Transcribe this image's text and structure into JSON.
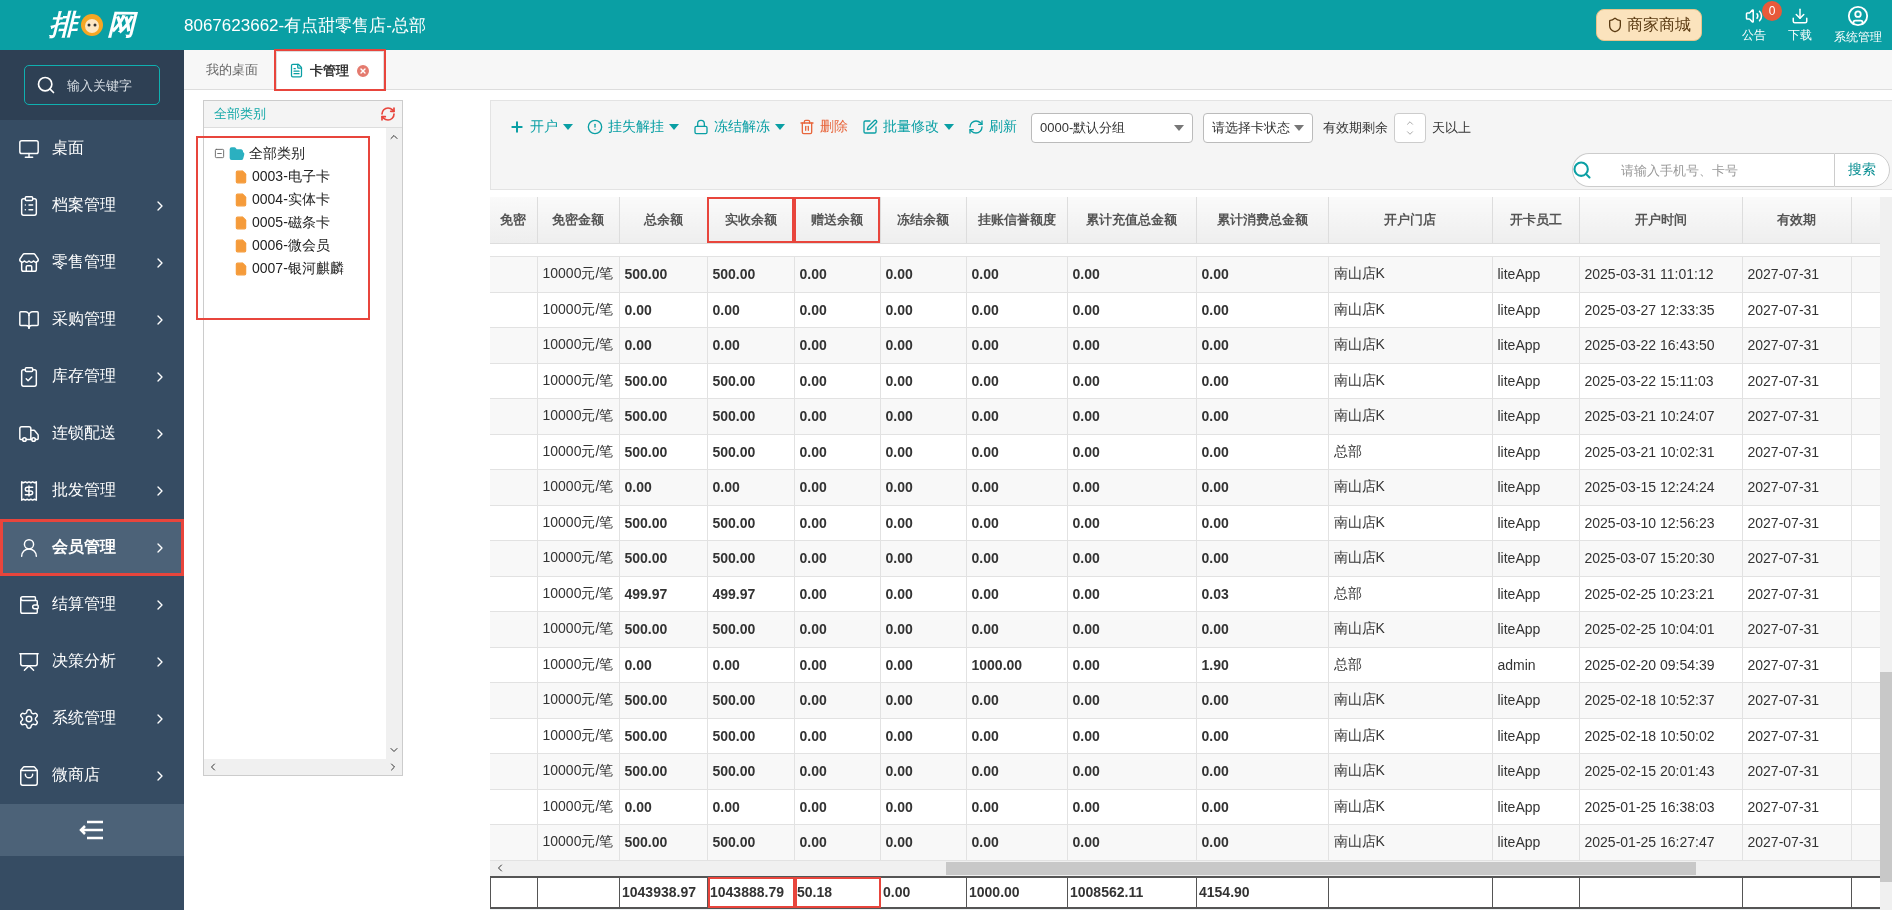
{
  "header": {
    "logo": {
      "left": "排",
      "right": "网"
    },
    "title": "8067623662-有点甜零售店-总部",
    "mall_button": "商家商城",
    "actions": [
      {
        "kind": "notice",
        "label": "公告",
        "badge": "0"
      },
      {
        "kind": "download",
        "label": "下载"
      },
      {
        "kind": "user",
        "label": "系统管理"
      }
    ]
  },
  "sidebar": {
    "search": {
      "placeholder": "输入关键字"
    },
    "items": [
      {
        "label": "桌面",
        "selected": false,
        "arrow": false
      },
      {
        "label": "档案管理",
        "selected": false,
        "arrow": true
      },
      {
        "label": "零售管理",
        "selected": false,
        "arrow": true
      },
      {
        "label": "采购管理",
        "selected": false,
        "arrow": true
      },
      {
        "label": "库存管理",
        "selected": false,
        "arrow": true
      },
      {
        "label": "连锁配送",
        "selected": false,
        "arrow": true
      },
      {
        "label": "批发管理",
        "selected": false,
        "arrow": true
      },
      {
        "label": "会员管理",
        "selected": true,
        "arrow": true,
        "marked": true
      },
      {
        "label": "结算管理",
        "selected": false,
        "arrow": true
      },
      {
        "label": "决策分析",
        "selected": false,
        "arrow": true
      },
      {
        "label": "系统管理",
        "selected": false,
        "arrow": true
      },
      {
        "label": "微商店",
        "selected": false,
        "arrow": true
      }
    ]
  },
  "tabs": [
    {
      "label": "我的桌面",
      "selected": false,
      "closable": false,
      "marked": false
    },
    {
      "label": "卡管理",
      "selected": true,
      "closable": true,
      "marked": true
    }
  ],
  "tree": {
    "title": "全部类别",
    "marked": true,
    "root": {
      "label": "全部类别",
      "expanded": true,
      "children": [
        {
          "label": "0003-电子卡"
        },
        {
          "label": "0004-实体卡"
        },
        {
          "label": "0005-磁条卡"
        },
        {
          "label": "0006-微会员"
        },
        {
          "label": "0007-银河麒麟"
        }
      ]
    }
  },
  "toolbar": {
    "actions": [
      {
        "kind": "add",
        "label": "开户",
        "dropdown": true
      },
      {
        "kind": "alert",
        "label": "挂失解挂",
        "dropdown": true
      },
      {
        "kind": "lock",
        "label": "冻结解冻",
        "dropdown": true
      },
      {
        "kind": "delete",
        "label": "删除",
        "dropdown": false
      },
      {
        "kind": "edit",
        "label": "批量修改",
        "dropdown": true
      },
      {
        "kind": "refresh",
        "label": "刷新",
        "dropdown": false
      }
    ],
    "group_select": {
      "value": "0000-默认分组"
    },
    "status_select": {
      "placeholder": "请选择卡状态"
    },
    "expiry": {
      "label": "有效期剩余",
      "suffix": "天以上"
    },
    "search": {
      "placeholder": "请输入手机号、卡号",
      "button": "搜索"
    }
  },
  "table": {
    "columns": [
      {
        "label": "免密",
        "marked": false
      },
      {
        "label": "免密金额",
        "marked": false
      },
      {
        "label": "总余额",
        "marked": false
      },
      {
        "label": "实收余额",
        "marked": true
      },
      {
        "label": "赠送余额",
        "marked": true
      },
      {
        "label": "冻结余额",
        "marked": false
      },
      {
        "label": "挂账信誉额度",
        "marked": false
      },
      {
        "label": "累计充值总金额",
        "marked": false
      },
      {
        "label": "累计消费总金额",
        "marked": false
      },
      {
        "label": "开户门店",
        "marked": false
      },
      {
        "label": "开卡员工",
        "marked": false
      },
      {
        "label": "开户时间",
        "marked": false
      },
      {
        "label": "有效期",
        "marked": false
      }
    ],
    "rows": [
      {
        "cells": [
          "",
          "10000元/笔",
          "500.00",
          "500.00",
          "0.00",
          "0.00",
          "0.00",
          "0.00",
          "0.00",
          "南山店K",
          "liteApp",
          "2025-03-31 11:01:12",
          "2027-07-31"
        ]
      },
      {
        "cells": [
          "",
          "10000元/笔",
          "0.00",
          "0.00",
          "0.00",
          "0.00",
          "0.00",
          "0.00",
          "0.00",
          "南山店K",
          "liteApp",
          "2025-03-27 12:33:35",
          "2027-07-31"
        ]
      },
      {
        "cells": [
          "",
          "10000元/笔",
          "0.00",
          "0.00",
          "0.00",
          "0.00",
          "0.00",
          "0.00",
          "0.00",
          "南山店K",
          "liteApp",
          "2025-03-22 16:43:50",
          "2027-07-31"
        ]
      },
      {
        "cells": [
          "",
          "10000元/笔",
          "500.00",
          "500.00",
          "0.00",
          "0.00",
          "0.00",
          "0.00",
          "0.00",
          "南山店K",
          "liteApp",
          "2025-03-22 15:11:03",
          "2027-07-31"
        ]
      },
      {
        "cells": [
          "",
          "10000元/笔",
          "500.00",
          "500.00",
          "0.00",
          "0.00",
          "0.00",
          "0.00",
          "0.00",
          "南山店K",
          "liteApp",
          "2025-03-21 10:24:07",
          "2027-07-31"
        ]
      },
      {
        "cells": [
          "",
          "10000元/笔",
          "500.00",
          "500.00",
          "0.00",
          "0.00",
          "0.00",
          "0.00",
          "0.00",
          "总部",
          "liteApp",
          "2025-03-21 10:02:31",
          "2027-07-31"
        ]
      },
      {
        "cells": [
          "",
          "10000元/笔",
          "0.00",
          "0.00",
          "0.00",
          "0.00",
          "0.00",
          "0.00",
          "0.00",
          "南山店K",
          "liteApp",
          "2025-03-15 12:24:24",
          "2027-07-31"
        ]
      },
      {
        "cells": [
          "",
          "10000元/笔",
          "500.00",
          "500.00",
          "0.00",
          "0.00",
          "0.00",
          "0.00",
          "0.00",
          "南山店K",
          "liteApp",
          "2025-03-10 12:56:23",
          "2027-07-31"
        ]
      },
      {
        "cells": [
          "",
          "10000元/笔",
          "500.00",
          "500.00",
          "0.00",
          "0.00",
          "0.00",
          "0.00",
          "0.00",
          "南山店K",
          "liteApp",
          "2025-03-07 15:20:30",
          "2027-07-31"
        ]
      },
      {
        "cells": [
          "",
          "10000元/笔",
          "499.97",
          "499.97",
          "0.00",
          "0.00",
          "0.00",
          "0.00",
          "0.03",
          "总部",
          "liteApp",
          "2025-02-25 10:23:21",
          "2027-07-31"
        ]
      },
      {
        "cells": [
          "",
          "10000元/笔",
          "500.00",
          "500.00",
          "0.00",
          "0.00",
          "0.00",
          "0.00",
          "0.00",
          "南山店K",
          "liteApp",
          "2025-02-25 10:04:01",
          "2027-07-31"
        ]
      },
      {
        "cells": [
          "",
          "10000元/笔",
          "0.00",
          "0.00",
          "0.00",
          "0.00",
          "1000.00",
          "0.00",
          "1.90",
          "总部",
          "admin",
          "2025-02-20 09:54:39",
          "2027-07-31"
        ]
      },
      {
        "cells": [
          "",
          "10000元/笔",
          "500.00",
          "500.00",
          "0.00",
          "0.00",
          "0.00",
          "0.00",
          "0.00",
          "南山店K",
          "liteApp",
          "2025-02-18 10:52:37",
          "2027-07-31"
        ]
      },
      {
        "cells": [
          "",
          "10000元/笔",
          "500.00",
          "500.00",
          "0.00",
          "0.00",
          "0.00",
          "0.00",
          "0.00",
          "南山店K",
          "liteApp",
          "2025-02-18 10:50:02",
          "2027-07-31"
        ]
      },
      {
        "cells": [
          "",
          "10000元/笔",
          "500.00",
          "500.00",
          "0.00",
          "0.00",
          "0.00",
          "0.00",
          "0.00",
          "南山店K",
          "liteApp",
          "2025-02-15 20:01:43",
          "2027-07-31"
        ]
      },
      {
        "cells": [
          "",
          "10000元/笔",
          "0.00",
          "0.00",
          "0.00",
          "0.00",
          "0.00",
          "0.00",
          "0.00",
          "南山店K",
          "liteApp",
          "2025-01-25 16:38:03",
          "2027-07-31"
        ]
      },
      {
        "cells": [
          "",
          "10000元/笔",
          "500.00",
          "500.00",
          "0.00",
          "0.00",
          "0.00",
          "0.00",
          "0.00",
          "南山店K",
          "liteApp",
          "2025-01-25 16:27:47",
          "2027-07-31"
        ]
      }
    ],
    "footer": [
      {
        "marked": false
      },
      {
        "marked": false
      },
      {
        "text": "1043938.97",
        "marked": false
      },
      {
        "text": "1043888.79",
        "marked": true
      },
      {
        "text": "50.18",
        "marked": true
      },
      {
        "text": "0.00",
        "marked": false
      },
      {
        "text": "1000.00",
        "marked": false
      },
      {
        "text": "1008562.11",
        "marked": false
      },
      {
        "text": "4154.90",
        "marked": false
      },
      {
        "marked": false
      },
      {
        "marked": false
      },
      {
        "marked": false
      },
      {
        "marked": false
      }
    ]
  }
}
